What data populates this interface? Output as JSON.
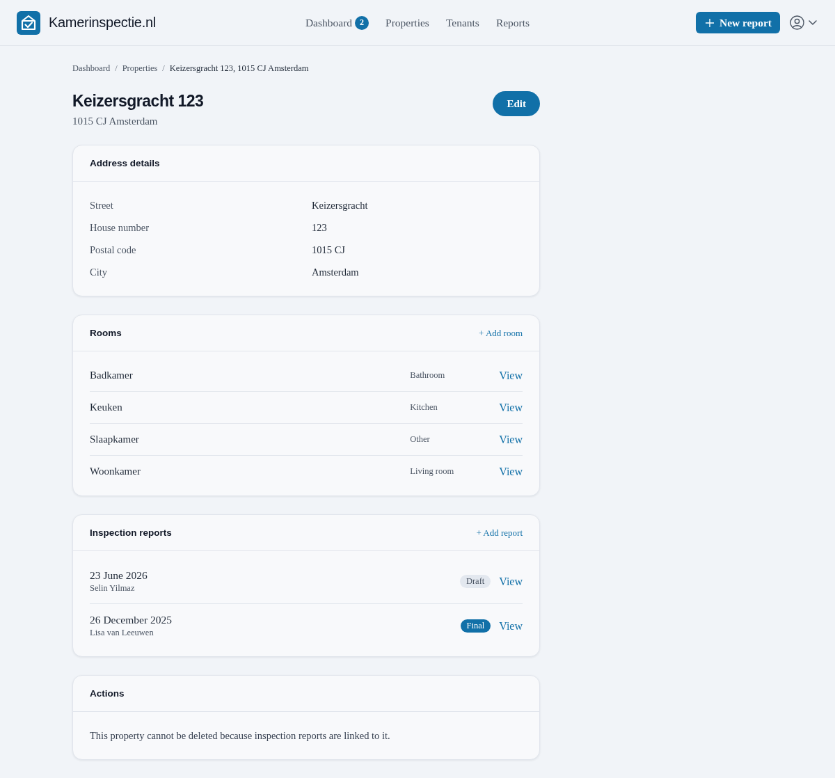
{
  "brand": {
    "name": "Kamerinspectie.nl"
  },
  "nav": [
    {
      "label": "Dashboard",
      "badge": "2"
    },
    {
      "label": "Properties"
    },
    {
      "label": "Tenants"
    },
    {
      "label": "Reports"
    }
  ],
  "header_actions": {
    "new_report": "New report"
  },
  "breadcrumb": [
    {
      "label": "Dashboard",
      "separator": "/"
    },
    {
      "label": "Properties",
      "separator": "/"
    },
    {
      "label": "Keizersgracht 123, 1015 CJ Amsterdam"
    }
  ],
  "page": {
    "title": "Keizersgracht 123",
    "subtitle": "1015 CJ Amsterdam",
    "edit": "Edit"
  },
  "address_details": {
    "title": "Address details",
    "fields": [
      {
        "label": "Street",
        "value": "Keizersgracht"
      },
      {
        "label": "House number",
        "value": "123"
      },
      {
        "label": "Postal code",
        "value": "1015 CJ"
      },
      {
        "label": "City",
        "value": "Amsterdam"
      }
    ]
  },
  "rooms": {
    "title": "Rooms",
    "add": "+ Add room",
    "items": [
      {
        "name": "Badkamer",
        "type": "Bathroom",
        "action": "View"
      },
      {
        "name": "Keuken",
        "type": "Kitchen",
        "action": "View"
      },
      {
        "name": "Slaapkamer",
        "type": "Other",
        "action": "View"
      },
      {
        "name": "Woonkamer",
        "type": "Living room",
        "action": "View"
      }
    ]
  },
  "inspection_reports": {
    "title": "Inspection reports",
    "add": "+ Add report",
    "items": [
      {
        "date": "23 June 2026",
        "inspector": "Selin Yilmaz",
        "status": {
          "kind": "draft",
          "label": "Draft"
        },
        "action": "View"
      },
      {
        "date": "26 December 2025",
        "inspector": "Lisa van Leeuwen",
        "status": {
          "kind": "final",
          "label": "Final"
        },
        "action": "View"
      }
    ]
  },
  "actions": {
    "title": "Actions",
    "message": "This property cannot be deleted because inspection reports are linked to it."
  }
}
